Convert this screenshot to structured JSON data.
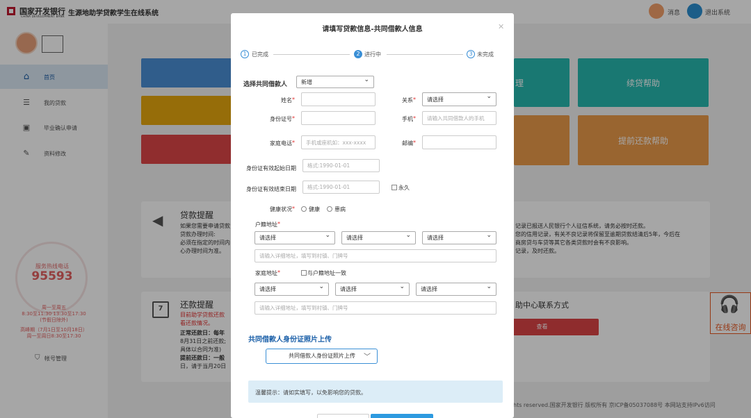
{
  "header": {
    "bank_name": "国家开发银行",
    "bank_name_en": "CHINA DEVELOPMENT BANK",
    "system_name": "生源地助学贷款学生在线系统",
    "messages_label": "消息",
    "logout_label": "退出系统"
  },
  "sidebar": {
    "items": [
      {
        "label": "首页",
        "icon": "home-icon"
      },
      {
        "label": "我的贷款",
        "icon": "list-icon"
      },
      {
        "label": "毕业确认申请",
        "icon": "graduation-icon"
      },
      {
        "label": "资料修改",
        "icon": "edit-icon"
      }
    ],
    "hotline_label": "服务热线电话",
    "hotline_number": "95593",
    "hotline_lines": [
      "周一至周五",
      "8:30至11:30 13:30至17:30",
      "(节假日除外)",
      "高峰期（7月1日至10月18日）",
      "周一至周日8:30至17:30"
    ],
    "account_label": "帐号管理"
  },
  "tiles": {
    "mid_teal": "理",
    "renew": "续贷帮助",
    "early_repay": "提前还款帮助"
  },
  "notice1": {
    "title": "贷款提醒",
    "left_lines": [
      "如果您需要申请贷款",
      "贷款办理时间:",
      "必须在指定的时间内",
      "心办理时间为准。"
    ],
    "right_lines": [
      "记录已报送人民银行个人征信系统，请务必按时还款。",
      "您的信用记录，有关不良记录将保留至逾期贷款结清后5年，今后在",
      "商房贷与车贷等其它各类贷款时会有不良影响。",
      "记录，及时还款。"
    ]
  },
  "notice2": {
    "title": "还款提醒",
    "red_lines": [
      "目前助学贷款还款",
      "看还款情况。"
    ],
    "lines": [
      {
        "text": "正常还款日：每年",
        "bold": true
      },
      {
        "text": "8月31日之前还款;",
        "bold": false
      },
      {
        "text": "具体以合同为准)",
        "bold": false
      },
      {
        "text": "提前还款日：一般",
        "bold": true
      },
      {
        "text": "日，请于当月20日",
        "bold": false
      }
    ],
    "contact_title": "助中心联系方式",
    "view_button": "查看"
  },
  "online_consult": "在线咨询",
  "footer": "hts reserved.国家开发银行 版权所有 京ICP备05037088号 本网站支持IPv6访问",
  "modal": {
    "title": "请填写贷款信息-共同借款人信息",
    "steps": [
      {
        "num": "1",
        "label": "已完成"
      },
      {
        "num": "2",
        "label": "进行中"
      },
      {
        "num": "3",
        "label": "未完成"
      }
    ],
    "coborrower_label": "选择共同借款人",
    "coborrower_value": "新增",
    "fields": {
      "name_label": "姓名",
      "relation_label": "关系",
      "relation_value": "请选择",
      "id_label": "身份证号",
      "phone_label": "手机",
      "phone_placeholder": "请输入共同借款人的手机",
      "home_phone_label": "家庭电话",
      "home_phone_placeholder": "手机或座机如：xxx-xxxx",
      "postcode_label": "邮编",
      "id_start_label": "身份证有效起始日期",
      "id_start_placeholder": "格式:1990-01-01",
      "id_end_label": "身份证有效结束日期",
      "id_end_placeholder": "格式:1990-01-01",
      "permanent_label": "永久",
      "health_label": "健康状况",
      "health_options": [
        "健康",
        "患病"
      ],
      "hukou_label": "户籍地址",
      "select_placeholder": "请选择",
      "address_placeholder": "请输入详细地址，填写到村镇、门牌号",
      "home_addr_label": "家庭地址",
      "same_as_hukou": "与户籍地址一致"
    },
    "upload_title": "共同借款人身份证照片上传",
    "upload_button": "共同借款人身份证照片上传",
    "tip": "温馨提示：请如实填写，以免影响您的贷款。"
  }
}
